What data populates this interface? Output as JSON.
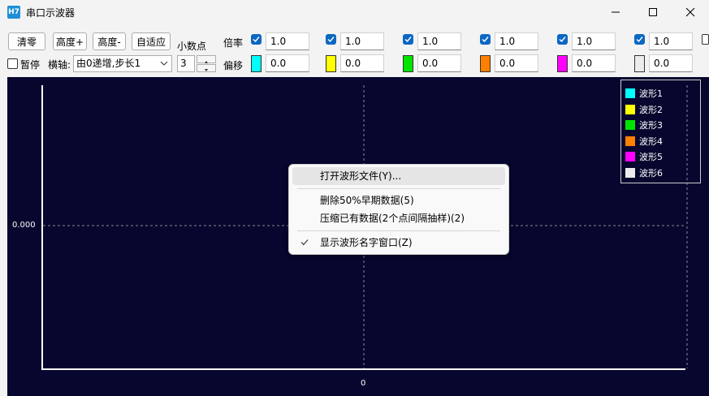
{
  "window": {
    "icon_text": "H7",
    "title": "串口示波器"
  },
  "toolbar": {
    "clear_label": "清零",
    "height_plus_label": "高度+",
    "height_minus_label": "高度-",
    "autofit_label": "自适应",
    "decimal_label": "小数点",
    "scale_label": "倍率",
    "offset_label": "偏移",
    "pause_label": "暂停",
    "pause_checked": false,
    "xaxis_label": "横轴:",
    "xaxis_value": "由0递增,步长1",
    "decimals_value": "3"
  },
  "channels": [
    {
      "enabled": true,
      "scale": "1.0",
      "offset": "0.0",
      "color": "#00ffff"
    },
    {
      "enabled": true,
      "scale": "1.0",
      "offset": "0.0",
      "color": "#ffff00"
    },
    {
      "enabled": true,
      "scale": "1.0",
      "offset": "0.0",
      "color": "#00e400"
    },
    {
      "enabled": true,
      "scale": "1.0",
      "offset": "0.0",
      "color": "#ff8000"
    },
    {
      "enabled": true,
      "scale": "1.0",
      "offset": "0.0",
      "color": "#ff00ff"
    },
    {
      "enabled": true,
      "scale": "1.0",
      "offset": "0.0",
      "color": "#ececec"
    }
  ],
  "plot": {
    "background": "#06062e",
    "y_tick": "0.000",
    "x_tick": "0"
  },
  "legend": [
    {
      "name": "波形1",
      "color": "#00ffff"
    },
    {
      "name": "波形2",
      "color": "#ffff00"
    },
    {
      "name": "波形3",
      "color": "#00e400"
    },
    {
      "name": "波形4",
      "color": "#ff8000"
    },
    {
      "name": "波形5",
      "color": "#ff00ff"
    },
    {
      "name": "波形6",
      "color": "#ececec"
    }
  ],
  "context_menu": {
    "open_file": "打开波形文件(Y)...",
    "delete_early": "删除50%早期数据(5)",
    "compress": "压缩已有数据(2个点间隔抽样)(2)",
    "show_names": "显示波形名字窗口(Z)",
    "show_names_checked": true
  }
}
